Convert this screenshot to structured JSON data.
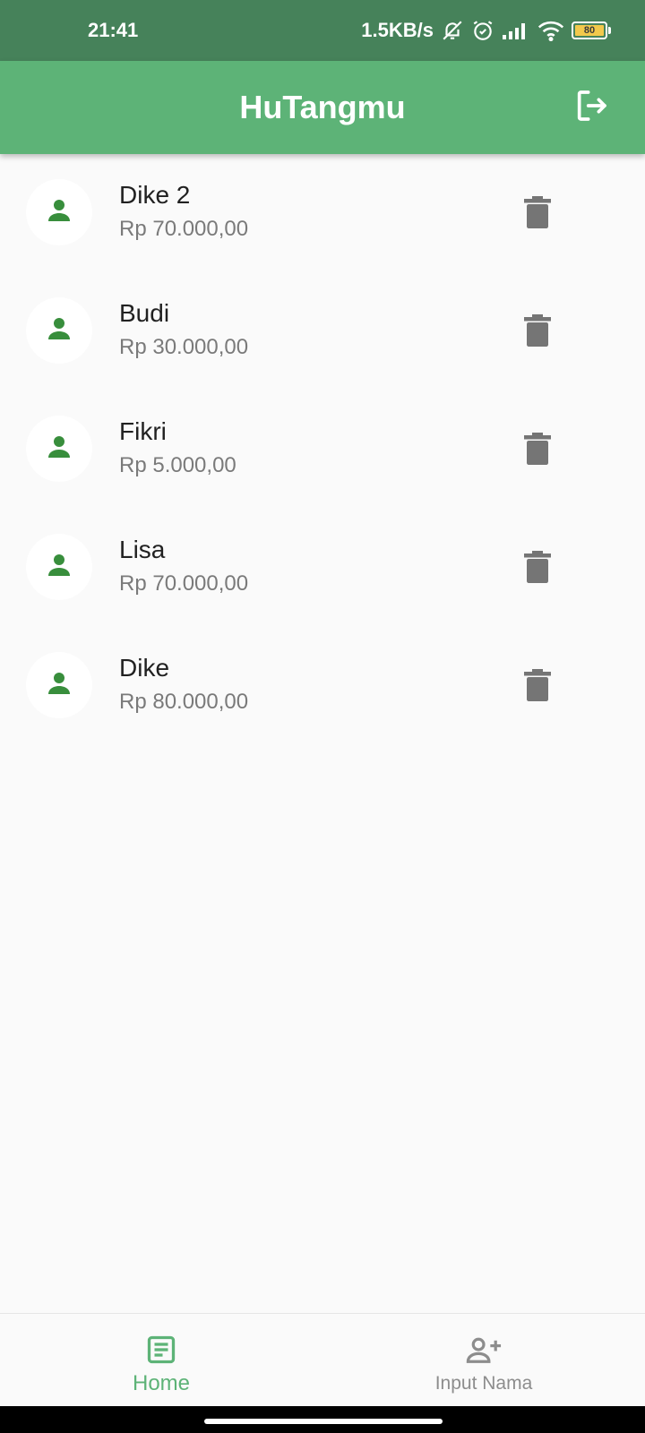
{
  "status_bar": {
    "time": "21:41",
    "net_speed": "1.5KB/s",
    "battery_level": "80",
    "icons": [
      "mute-icon",
      "alarm-icon",
      "signal-icon",
      "wifi-icon",
      "battery-icon"
    ]
  },
  "app_bar": {
    "title": "HuTangmu",
    "action_icon": "logout-icon"
  },
  "debts": [
    {
      "name": "Dike 2",
      "amount": "Rp 70.000,00"
    },
    {
      "name": "Budi",
      "amount": "Rp 30.000,00"
    },
    {
      "name": "Fikri",
      "amount": "Rp 5.000,00"
    },
    {
      "name": "Lisa",
      "amount": "Rp 70.000,00"
    },
    {
      "name": "Dike",
      "amount": "Rp 80.000,00"
    }
  ],
  "bottom_nav": {
    "items": [
      {
        "label": "Home",
        "icon": "list-icon",
        "active": true
      },
      {
        "label": "Input Nama",
        "icon": "add-person-icon",
        "active": false
      }
    ]
  },
  "colors": {
    "status_bar": "#46825a",
    "primary": "#5db377",
    "avatar_icon": "#388e3c",
    "delete_icon": "#757575",
    "background": "#fafafa"
  }
}
